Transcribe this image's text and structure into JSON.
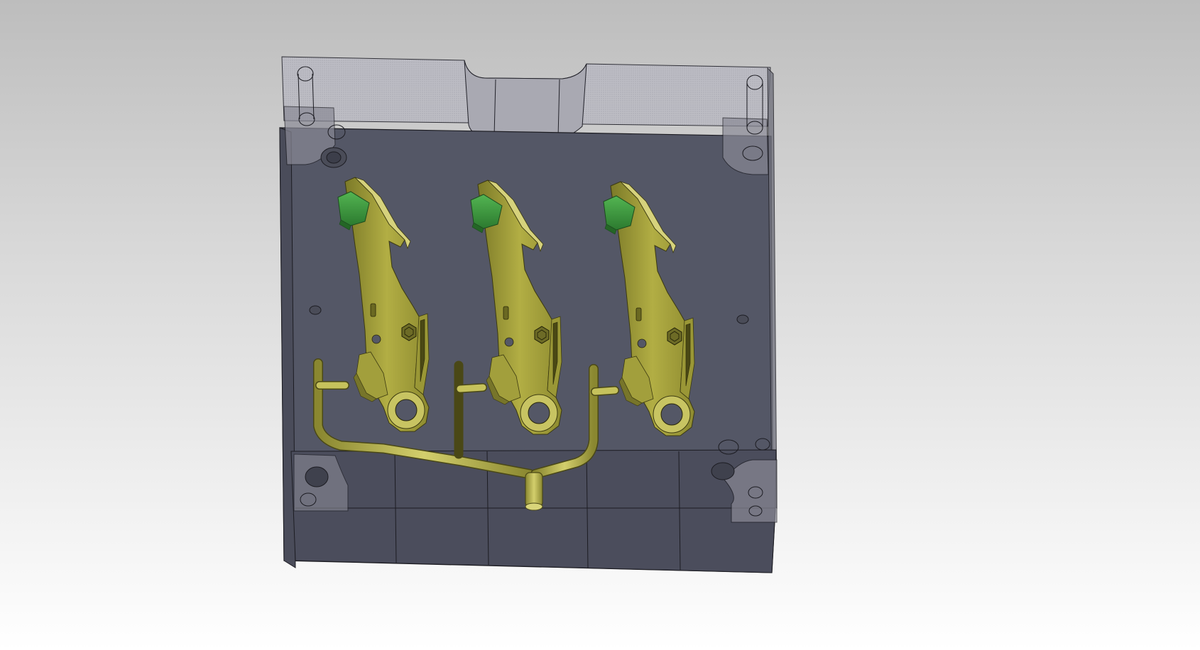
{
  "viewport": {
    "background_top": "#bdbdbd",
    "background_bottom": "#ffffff"
  },
  "model": {
    "components": [
      "mold-base-transparent",
      "mold-cavity-plate",
      "lever-parts",
      "runner-system"
    ],
    "part_count": 3,
    "colors": {
      "plate_fill": "#545766",
      "plate_top_transparent": "#b9b9c0",
      "edge_lines": "#1c1c22",
      "part_fill": "#a9a539",
      "part_highlight": "#d4d17a",
      "part_shadow": "#5c5a1a",
      "insert_green": "#3a9a3e",
      "runner": "#b7b443"
    },
    "icons": [
      "hexagon-logo-icon"
    ]
  }
}
